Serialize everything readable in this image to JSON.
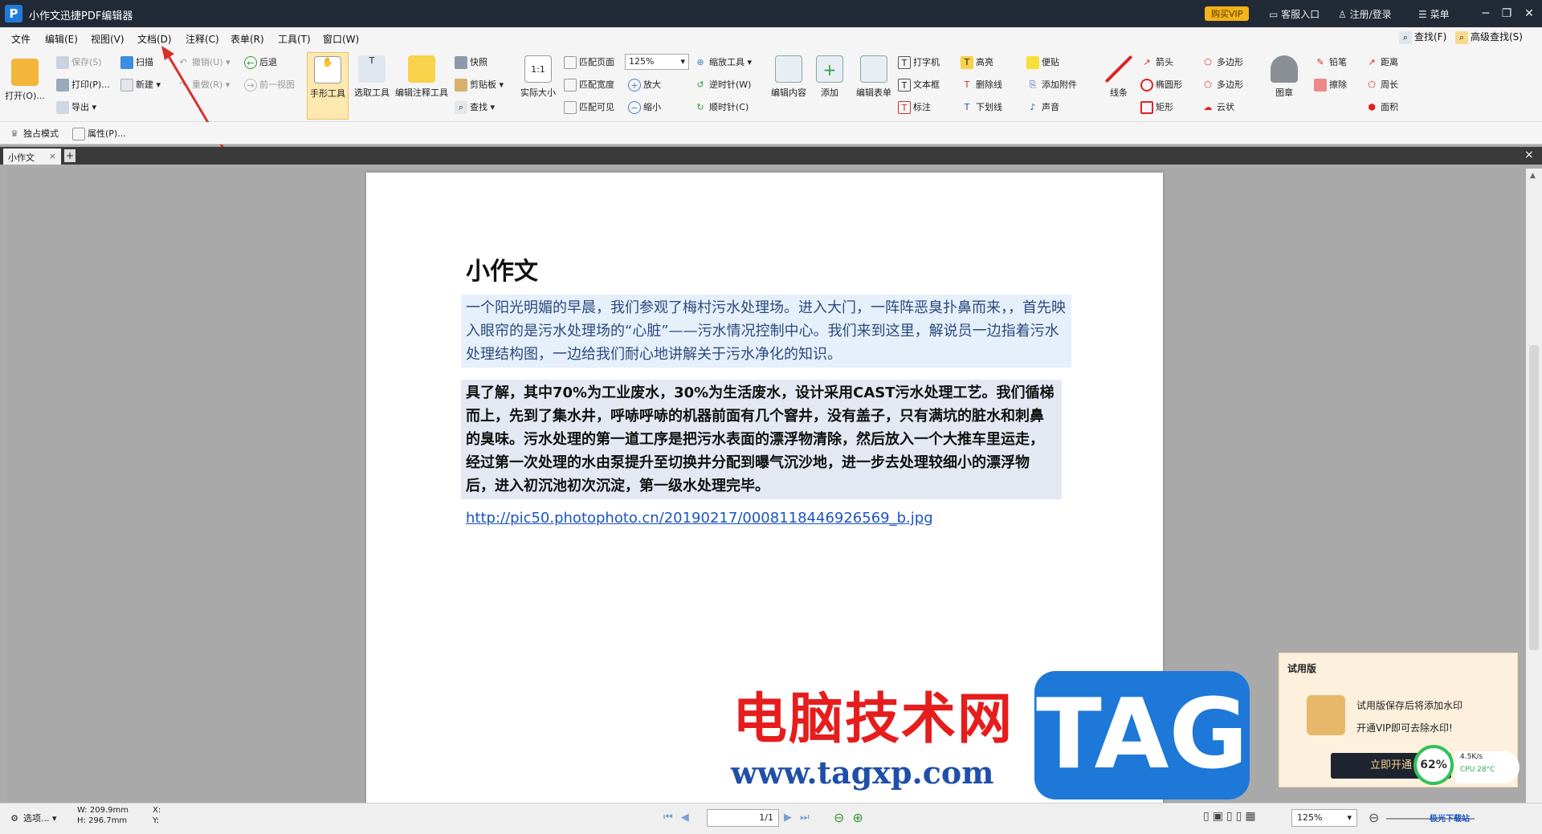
{
  "titlebar": {
    "app_title": "小作文迅捷PDF编辑器",
    "vip_button": "购买VIP",
    "service": "客服入口",
    "login": "注册/登录",
    "menu": "菜单"
  },
  "menubar": [
    "文件",
    "编辑(E)",
    "视图(V)",
    "文档(D)",
    "注释(C)",
    "表单(R)",
    "工具(T)",
    "窗口(W)"
  ],
  "menubar_right": {
    "find": "查找(F)",
    "adv_find": "高级查找(S)"
  },
  "toolbar": {
    "open": "打开(O)...",
    "save": "保存(S)",
    "print": "打印(P)...",
    "export": "导出",
    "scan": "扫描",
    "new": "新建",
    "undo": "撤销(U)",
    "redo": "重做(R)",
    "back": "后退",
    "prev_view": "前一视图",
    "hand": "手形工具",
    "select": "选取工具",
    "edit_annot": "编辑注释工具",
    "snapshot": "快照",
    "clipboard": "剪贴板",
    "search": "查找",
    "actual": "实际大小",
    "fit_page": "匹配页面",
    "fit_width": "匹配宽度",
    "fit_visible": "匹配可见",
    "zoom_value": "125%",
    "zoom_tool": "缩放工具",
    "zoom_in": "放大",
    "zoom_out": "缩小",
    "ccw": "逆时针(W)",
    "cw": "顺时针(C)",
    "edit_content": "编辑内容",
    "add": "添加",
    "edit_form": "编辑表单",
    "typewriter": "打字机",
    "textbox": "文本框",
    "callout": "标注",
    "highlight": "高亮",
    "strike": "删除线",
    "underline": "下划线",
    "note": "便贴",
    "attach": "添加附件",
    "sound": "声音",
    "line": "线条",
    "arrow": "箭头",
    "ellipse": "椭圆形",
    "rect": "矩形",
    "polygon1": "多边形",
    "polygon2": "多边形",
    "cloud": "云状",
    "stamp": "图章",
    "pencil": "铅笔",
    "eraser": "擦除",
    "distance": "距离",
    "perimeter": "周长",
    "area": "面积"
  },
  "toolbar2": {
    "exclusive": "独占模式",
    "properties": "属性(P)..."
  },
  "tab": {
    "name": "小作文",
    "add": "+",
    "close": "×"
  },
  "document": {
    "title": "小作文",
    "para1": "一个阳光明媚的早晨，我们参观了梅村污水处理场。进入大门，一阵阵恶臭扑鼻而来，，首先映入眼帘的是污水处理场的“心脏”——污水情况控制中心。我们来到这里，解说员一边指着污水处理结构图，一边给我们耐心地讲解关于污水净化的知识。",
    "para2": "具了解，其中70%为工业废水，30%为生活废水，设计采用CAST污水处理工艺。我们循梯而上，先到了集水井，呼哧呼哧的机器前面有几个窨井，没有盖子，只有满坑的脏水和刺鼻的臭味。污水处理的第一道工序是把污水表面的漂浮物清除，然后放入一个大推车里运走，经过第一次处理的水由泵提升至切换井分配到曝气沉沙地，进一步去处理较细小的漂浮物后，进入初沉池初次沉淀，第一级水处理完毕。",
    "link": "http://pic50.photophoto.cn/20190217/0008118446926569_b.jpg"
  },
  "trial_popup": {
    "header": "试用版",
    "line1": "试用版保存后将添加水印",
    "line2": "开通VIP即可去除水印!",
    "button": "立即开通"
  },
  "monitor": {
    "percent": "62%",
    "net": "4.5K/s",
    "cpu": "CPU 28°C"
  },
  "watermark": {
    "brand": "电脑技术网",
    "url": "www.tagxp.com",
    "tag": "TAG",
    "corner": "极光下载站"
  },
  "statusbar": {
    "options": "选项...",
    "width": "W: 209.9mm",
    "height": "H: 296.7mm",
    "x": "X:",
    "y": "Y:",
    "page": "1/1",
    "zoom": "125%"
  }
}
